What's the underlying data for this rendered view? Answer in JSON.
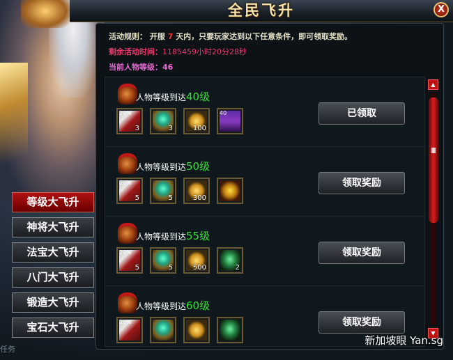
{
  "window": {
    "title": "全民飞升",
    "close_label": "X"
  },
  "info": {
    "rule_label": "活动规则：",
    "rule_pre": "开服",
    "rule_days": "7",
    "rule_post": "天内，只要玩家达到以下任意条件，即可领取奖励。",
    "time_label": "剩余活动时间：",
    "time_value": "1185459小时20分28秒",
    "level_label": "当前人物等级：",
    "level_value": "46"
  },
  "tabs": [
    {
      "label": "等级大飞升",
      "active": true
    },
    {
      "label": "神将大飞升",
      "active": false
    },
    {
      "label": "法宝大飞升",
      "active": false
    },
    {
      "label": "八门大飞升",
      "active": false
    },
    {
      "label": "锻造大飞升",
      "active": false
    },
    {
      "label": "宝石大飞升",
      "active": false
    }
  ],
  "rewards": [
    {
      "req_text": "人物等级到达",
      "req_level": "40级",
      "button": "已领取",
      "items": [
        {
          "icon": "scroll-icon",
          "tag": "20%",
          "count": "3"
        },
        {
          "icon": "orb-icon",
          "tag": "",
          "count": "3"
        },
        {
          "icon": "coin-icon",
          "tag": "",
          "count": "100"
        },
        {
          "icon": "chest-icon",
          "tag": "40",
          "count": ""
        }
      ]
    },
    {
      "req_text": "人物等级到达",
      "req_level": "50级",
      "button": "领取奖励",
      "items": [
        {
          "icon": "scroll-icon",
          "tag": "20%",
          "count": "5"
        },
        {
          "icon": "orb-icon",
          "tag": "",
          "count": "5"
        },
        {
          "icon": "coin-icon",
          "tag": "",
          "count": "300"
        },
        {
          "icon": "medal-icon",
          "tag": "",
          "count": ""
        }
      ]
    },
    {
      "req_text": "人物等级到达",
      "req_level": "55级",
      "button": "领取奖励",
      "items": [
        {
          "icon": "scroll-icon",
          "tag": "20%",
          "count": "5"
        },
        {
          "icon": "orb-icon",
          "tag": "",
          "count": "5"
        },
        {
          "icon": "coin-icon",
          "tag": "",
          "count": "500"
        },
        {
          "icon": "armor-icon",
          "tag": "",
          "count": "2"
        }
      ]
    },
    {
      "req_text": "人物等级到达",
      "req_level": "60级",
      "button": "领取奖励",
      "items": [
        {
          "icon": "scroll-icon",
          "tag": "20%",
          "count": ""
        },
        {
          "icon": "orb-icon",
          "tag": "",
          "count": ""
        },
        {
          "icon": "coin-icon",
          "tag": "",
          "count": ""
        },
        {
          "icon": "armor-icon",
          "tag": "",
          "count": ""
        }
      ]
    }
  ],
  "scrollbar": {
    "up_label": "▲",
    "down_label": "▼",
    "position": 0.1
  },
  "watermark": "新加坡眼 Yan.sg",
  "bottom_hint": "任务",
  "colors": {
    "accent_red": "#b01010",
    "level_green": "#38e038",
    "time_pink": "#e83a6a",
    "level_magenta": "#e66ad0"
  }
}
